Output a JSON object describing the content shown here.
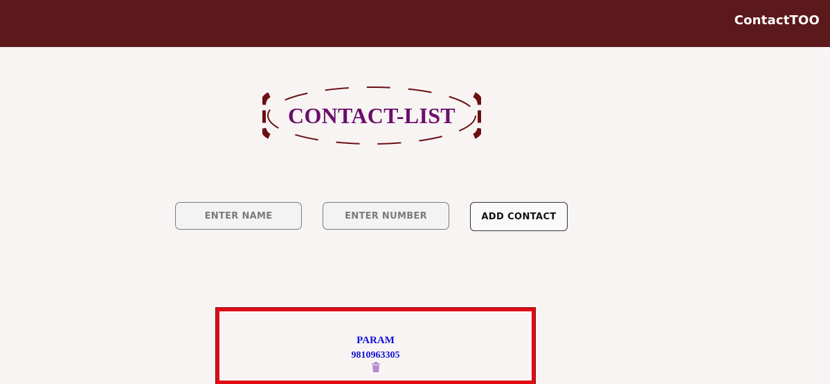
{
  "app": {
    "brand": "ContactTOO"
  },
  "main": {
    "heading": "CONTACT-LIST"
  },
  "form": {
    "name_placeholder": "ENTER NAME",
    "name_value": "",
    "number_placeholder": "ENTER NUMBER",
    "number_value": "",
    "add_label": "ADD CONTACT"
  },
  "contacts": [
    {
      "name": "PARAM",
      "number": "9810963305",
      "delete_icon": "trash-icon"
    }
  ],
  "colors": {
    "navbar": "#5c191b",
    "background": "#f8f4f4",
    "heading": "#6b0f6b",
    "card_border": "#e10b14",
    "contact_text": "#1010d8",
    "trash_icon": "#b58ad0"
  }
}
